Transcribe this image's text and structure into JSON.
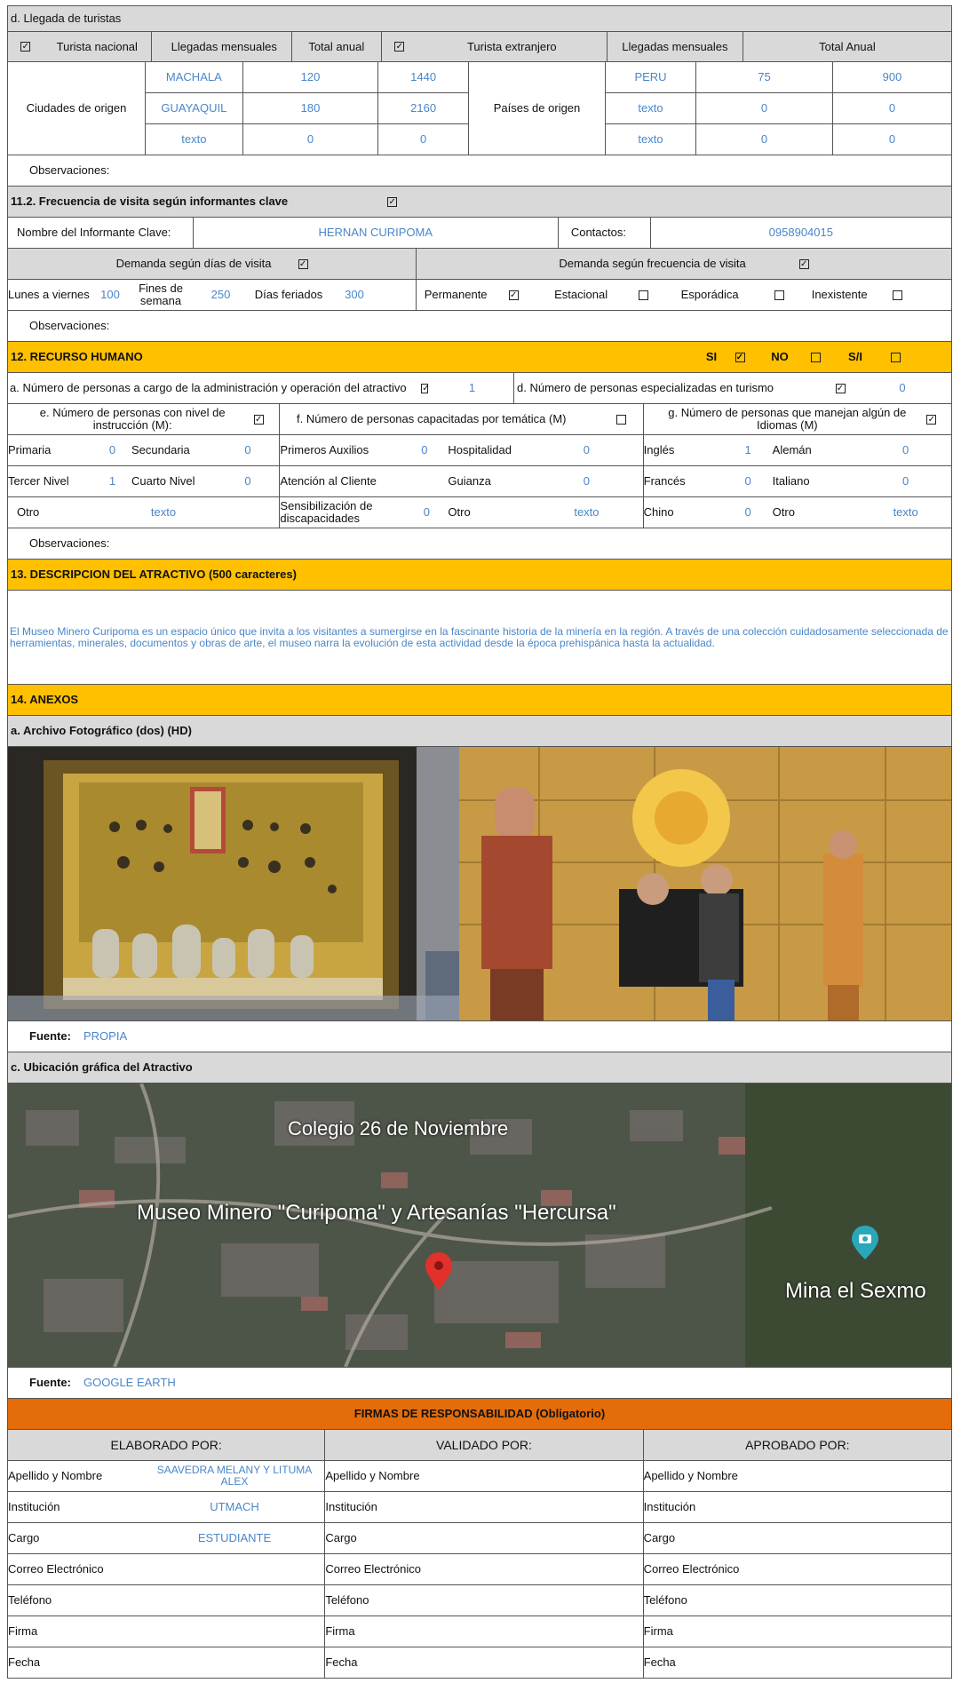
{
  "s11": {
    "llegada_header": "d. Llegada de turistas",
    "nacional": {
      "label": "Turista nacional",
      "mensual_label": "Llegadas mensuales",
      "anual_label": "Total anual",
      "origen_label": "Ciudades de origen",
      "rows": [
        [
          "MACHALA",
          "120",
          "1440"
        ],
        [
          "GUAYAQUIL",
          "180",
          "2160"
        ],
        [
          "texto",
          "0",
          "0"
        ]
      ]
    },
    "extranjero": {
      "label": "Turista extranjero",
      "mensual_label": "Llegadas mensuales",
      "anual_label": "Total Anual",
      "origen_label": "Países de origen",
      "rows": [
        [
          "PERU",
          "75",
          "900"
        ],
        [
          "texto",
          "0",
          "0"
        ],
        [
          "texto",
          "0",
          "0"
        ]
      ]
    },
    "obs1": "Observaciones:",
    "freq_title": "11.2. Frecuencia de visita según informantes clave",
    "informante_label": "Nombre del Informante Clave:",
    "informante_value": "HERNAN CURIPOMA",
    "contactos_label": "Contactos:",
    "contactos_value": "0958904015",
    "demanda_dias": "Demanda según  días de visita",
    "demanda_freq": "Demanda según frecuencia de visita",
    "lunes_label": "Lunes a viernes",
    "lunes_value": "100",
    "fines_label": "Fines de semana",
    "fines_value": "250",
    "feriados_label": "Días feriados",
    "feriados_value": "300",
    "permanente": "Permanente",
    "estacional": "Estacional",
    "esporadica": "Esporádica",
    "inexistente": "Inexistente",
    "obs2": "Observaciones:"
  },
  "s12": {
    "title": "12. RECURSO HUMANO",
    "si": "SI",
    "no": "NO",
    "si_no": "S/I",
    "a_label": "a. Número de personas a cargo de la administración y operación del atractivo",
    "a_value": "1",
    "d_label": "d. Número de personas especializadas en turismo",
    "d_value": "0",
    "e_label": "e. Número de personas con nivel de instrucción (M):",
    "f_label": "f. Número de personas capacitadas por temática (M)",
    "g_label": "g. Número de personas que manejan algún de Idiomas (M)",
    "primaria": "Primaria",
    "primaria_v": "0",
    "secundaria": "Secundaria",
    "secundaria_v": "0",
    "primeros": "Primeros Auxilios",
    "primeros_v": "0",
    "hospitalidad": "Hospitalidad",
    "hospitalidad_v": "0",
    "ingles": "Inglés",
    "ingles_v": "1",
    "aleman": "Alemán",
    "aleman_v": "0",
    "tercer": "Tercer Nivel",
    "tercer_v": "1",
    "cuarto": "Cuarto Nivel",
    "cuarto_v": "0",
    "atencion": "Atención al Cliente",
    "guianza": "Guianza",
    "guianza_v": "0",
    "frances": "Francés",
    "frances_v": "0",
    "italiano": "Italiano",
    "italiano_v": "0",
    "otro1": "Otro",
    "otro1_v": "texto",
    "sensib": "Sensibilización de discapacidades",
    "sensib_v": "0",
    "otro2": "Otro",
    "otro2_v": "texto",
    "chino": "Chino",
    "chino_v": "0",
    "otro3": "Otro",
    "otro3_v": "texto",
    "obs": "Observaciones:"
  },
  "s13": {
    "title": "13. DESCRIPCION DEL ATRACTIVO (500 caracteres)",
    "text": "El Museo Minero Curipoma es un espacio único que invita a los visitantes a sumergirse en la fascinante historia de la minería en la región. A través de una colección cuidadosamente seleccionada de herramientas, minerales, documentos y obras de arte, el museo narra la evolución de esta actividad desde la época prehispánica hasta la actualidad."
  },
  "s14": {
    "title": "14. ANEXOS",
    "foto_title": "a. Archivo Fotográfico (dos) (HD)",
    "fuente_label": "Fuente:",
    "fuente_foto": "PROPIA",
    "ubic_title": "c. Ubicación gráfica del Atractivo",
    "map_label1": "Colegio 26 de Noviembre",
    "map_label2": "Museo Minero \"Curipoma\" y Artesanías \"Hercursa\"",
    "map_label3": "Mina el Sexmo",
    "fuente_mapa": "GOOGLE EARTH"
  },
  "firmas": {
    "title": "FIRMAS DE RESPONSABILIDAD (Obligatorio)",
    "elaborado": "ELABORADO POR:",
    "validado": "VALIDADO  POR:",
    "aprobado": "APROBADO POR:",
    "apellido": "Apellido y Nombre",
    "institucion": "Institución",
    "cargo": "Cargo",
    "correo": "Correo Electrónico",
    "telefono": "Teléfono",
    "firma": "Firma",
    "fecha": "Fecha",
    "elab_nombre": "SAAVEDRA MELANY Y LITUMA ALEX",
    "elab_inst": "UTMACH",
    "elab_cargo": "ESTUDIANTE"
  },
  "colors": {
    "accent_orange": "#ffc000",
    "header_orange": "#e46c0a",
    "value_blue": "#4a86c8",
    "header_gray": "#d9d9d9"
  }
}
